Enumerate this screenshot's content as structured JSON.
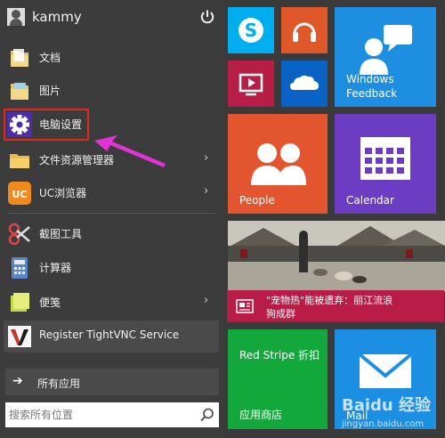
{
  "user": {
    "name": "kammy"
  },
  "apps": [
    {
      "label": "文档",
      "icon": "folder-icon",
      "has_arrow": false
    },
    {
      "label": "图片",
      "icon": "folder-icon",
      "has_arrow": false
    },
    {
      "label": "电脑设置",
      "icon": "gear-icon",
      "has_arrow": false
    },
    {
      "label": "文件资源管理器",
      "icon": "folder-icon",
      "has_arrow": true
    },
    {
      "label": "UC浏览器",
      "icon": "uc-browser-icon",
      "has_arrow": true
    },
    {
      "label": "截图工具",
      "icon": "scissors-icon",
      "has_arrow": false
    },
    {
      "label": "计算器",
      "icon": "calculator-icon",
      "has_arrow": false
    },
    {
      "label": "便笺",
      "icon": "sticky-notes-icon",
      "has_arrow": true
    },
    {
      "label": "Register TightVNC Service",
      "icon": "tightvnc-icon",
      "has_arrow": false
    }
  ],
  "all_apps": {
    "label": "所有应用",
    "arrow": "➔"
  },
  "search": {
    "placeholder": "搜索所有位置"
  },
  "tiles": {
    "skype": {
      "color": "#00aef0"
    },
    "music": {
      "color": "#e0572a"
    },
    "video": {
      "color": "#b81d45"
    },
    "onedrive": {
      "color": "#0a62c5"
    },
    "feedback": {
      "label": "Windows Feedback",
      "line1": "Windows",
      "line2": "Feedback",
      "color": "#1e8fe0"
    },
    "people": {
      "label": "People",
      "color": "#e2552e"
    },
    "calendar": {
      "label": "Calendar",
      "color": "#6c3cc2"
    },
    "news": {
      "caption_line1": "\"宠物热\"能被遗弃：丽江流浪",
      "caption_line2": "狗成群",
      "caption_color": "#b91d47"
    },
    "store": {
      "title": "Red Stripe 折扣",
      "label": "应用商店",
      "color": "#12a83c"
    },
    "mail": {
      "label": "Mail",
      "color": "#1c8fe3"
    }
  },
  "watermark": {
    "line1": "Baidu 经验",
    "line2": "jingyan.baidu.com"
  },
  "colors": {
    "highlight_box": "#e8251f",
    "pointer_arrow": "#e233d6",
    "start_bg": "#3c3c3c"
  }
}
